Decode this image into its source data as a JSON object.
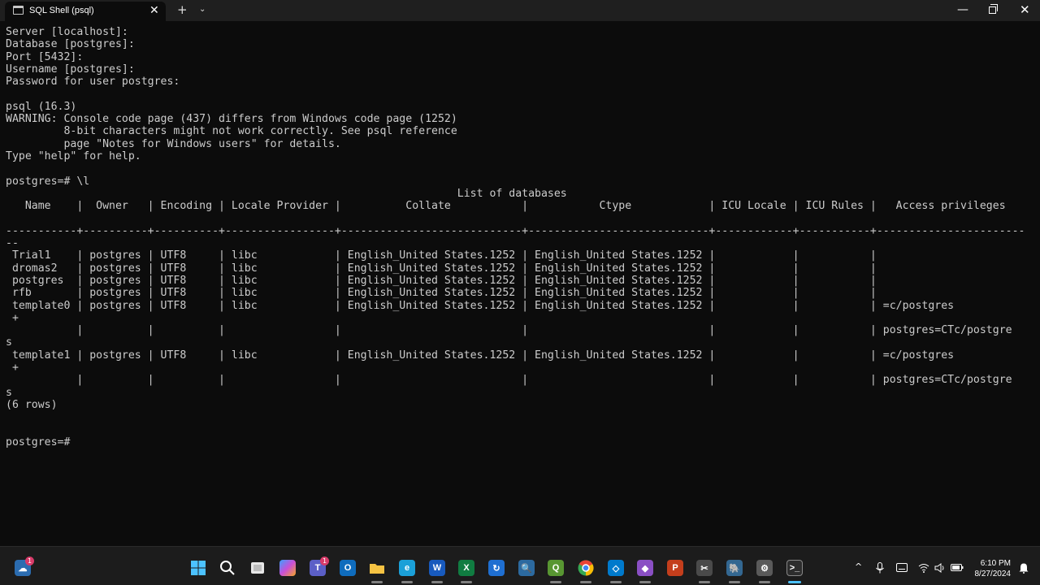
{
  "window": {
    "tab_title": "SQL Shell (psql)",
    "tab_close_glyph": "✕",
    "new_tab_glyph": "+",
    "dropdown_glyph": "⌄",
    "minimize_glyph": "—",
    "close_glyph": "✕"
  },
  "terminal": {
    "lines": [
      "Server [localhost]:",
      "Database [postgres]:",
      "Port [5432]:",
      "Username [postgres]:",
      "Password for user postgres:",
      "",
      "psql (16.3)",
      "WARNING: Console code page (437) differs from Windows code page (1252)",
      "         8-bit characters might not work correctly. See psql reference",
      "         page \"Notes for Windows users\" for details.",
      "Type \"help\" for help.",
      "",
      "postgres=# \\l",
      "                                                                      List of databases",
      "   Name    |  Owner   | Encoding | Locale Provider |          Collate           |           Ctype            | ICU Locale | ICU Rules |   Access privileges",
      "",
      "-----------+----------+----------+-----------------+----------------------------+----------------------------+------------+-----------+-----------------------",
      "--",
      " Trial1    | postgres | UTF8     | libc            | English_United States.1252 | English_United States.1252 |            |           |",
      " dromas2   | postgres | UTF8     | libc            | English_United States.1252 | English_United States.1252 |            |           |",
      " postgres  | postgres | UTF8     | libc            | English_United States.1252 | English_United States.1252 |            |           |",
      " rfb       | postgres | UTF8     | libc            | English_United States.1252 | English_United States.1252 |            |           |",
      " template0 | postgres | UTF8     | libc            | English_United States.1252 | English_United States.1252 |            |           | =c/postgres",
      " +",
      "           |          |          |                 |                            |                            |            |           | postgres=CTc/postgre",
      "s",
      " template1 | postgres | UTF8     | libc            | English_United States.1252 | English_United States.1252 |            |           | =c/postgres",
      " +",
      "           |          |          |                 |                            |                            |            |           | postgres=CTc/postgre",
      "s",
      "(6 rows)",
      "",
      "",
      "postgres=#"
    ]
  },
  "taskbar": {
    "apps": [
      {
        "name": "widgets",
        "glyph": "☁",
        "color": "#2b6cb0"
      },
      {
        "name": "start",
        "glyph": "",
        "color": "#3a9be8"
      },
      {
        "name": "search",
        "glyph": "",
        "color": "transparent"
      },
      {
        "name": "task-view",
        "glyph": "",
        "color": "#cccccc"
      },
      {
        "name": "copilot",
        "glyph": "",
        "color": "#8a5cf5"
      },
      {
        "name": "teams",
        "glyph": "T",
        "color": "#5b5fc7"
      },
      {
        "name": "outlook",
        "glyph": "O",
        "color": "#0f6cbd"
      },
      {
        "name": "file-explorer",
        "glyph": "",
        "color": "#f2c94c"
      },
      {
        "name": "edge",
        "glyph": "e",
        "color": "#1ba0d8"
      },
      {
        "name": "word",
        "glyph": "W",
        "color": "#185abd"
      },
      {
        "name": "excel",
        "glyph": "X",
        "color": "#107c41"
      },
      {
        "name": "backup",
        "glyph": "↻",
        "color": "#1f6fd1"
      },
      {
        "name": "search-tool",
        "glyph": "🔍",
        "color": "#2c6aa0"
      },
      {
        "name": "qgis",
        "glyph": "Q",
        "color": "#589632"
      },
      {
        "name": "chrome",
        "glyph": "",
        "color": "#e94235"
      },
      {
        "name": "vscode",
        "glyph": "◇",
        "color": "#007acc"
      },
      {
        "name": "visual-studio",
        "glyph": "◆",
        "color": "#8a4fc4"
      },
      {
        "name": "powerpoint",
        "glyph": "P",
        "color": "#c43e1c"
      },
      {
        "name": "snipping",
        "glyph": "✂",
        "color": "#4a4a4a"
      },
      {
        "name": "pgadmin",
        "glyph": "🐘",
        "color": "#336791"
      },
      {
        "name": "settings",
        "glyph": "⚙",
        "color": "#5a5a5a"
      },
      {
        "name": "terminal",
        "glyph": ">_",
        "color": "#2d2d2d"
      }
    ],
    "badges": {
      "widgets": "1",
      "teams": "1"
    },
    "tray": {
      "chevron": "^",
      "clock_time": "6:10 PM",
      "clock_date": "8/27/2024"
    }
  }
}
